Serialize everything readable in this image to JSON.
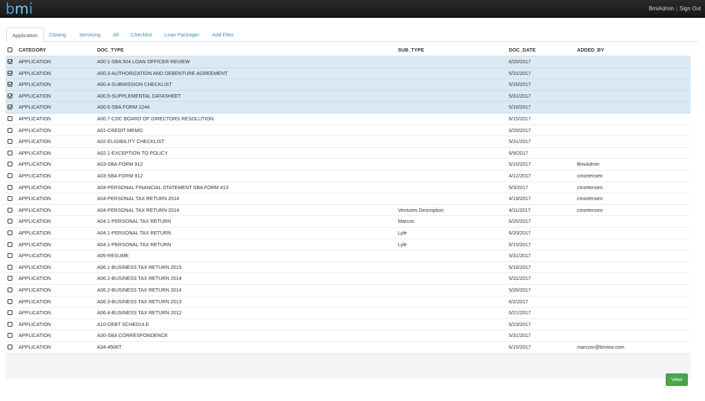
{
  "header": {
    "logo_prefix": "b",
    "logo_hl": "m",
    "logo_suffix": "i",
    "user": "BmiAdmin",
    "separator": "|",
    "signout": "Sign Out"
  },
  "tabs": [
    {
      "label": "Application",
      "active": true
    },
    {
      "label": "Closing",
      "active": false
    },
    {
      "label": "Servicing",
      "active": false
    },
    {
      "label": "All",
      "active": false
    },
    {
      "label": "Checklist",
      "active": false
    },
    {
      "label": "Loan Packager",
      "active": false
    },
    {
      "label": "Add Files",
      "active": false
    }
  ],
  "table": {
    "columns": {
      "category": "CATEGORY",
      "doc_type": "DOC_TYPE",
      "sub_type": "SUB_TYPE",
      "doc_date": "DOC_DATE",
      "added_by": "ADDED_BY"
    },
    "rows": [
      {
        "checked": true,
        "category": "APPLICATION",
        "doc_type": "A00.1-SBA 504 LOAN OFFICER REVIEW",
        "sub_type": "",
        "doc_date": "6/20/2017",
        "added_by": ""
      },
      {
        "checked": true,
        "category": "APPLICATION",
        "doc_type": "A00.3-AUTHORIZATION AND DEBENTURE AGREEMENT",
        "sub_type": "",
        "doc_date": "5/31/2017",
        "added_by": ""
      },
      {
        "checked": true,
        "category": "APPLICATION",
        "doc_type": "A00.4-SUBMISSION CHECKLIST",
        "sub_type": "",
        "doc_date": "5/16/2017",
        "added_by": ""
      },
      {
        "checked": true,
        "category": "APPLICATION",
        "doc_type": "A00.5-SUPPLEMENTAL DATASHEET",
        "sub_type": "",
        "doc_date": "5/31/2017",
        "added_by": ""
      },
      {
        "checked": true,
        "category": "APPLICATION",
        "doc_type": "A00.6-SBA FORM 1244",
        "sub_type": "",
        "doc_date": "5/16/2017",
        "added_by": ""
      },
      {
        "checked": false,
        "category": "APPLICATION",
        "doc_type": "A00.7-CDC BOARD OF DIRECTORS RESOLUTION",
        "sub_type": "",
        "doc_date": "6/15/2017",
        "added_by": ""
      },
      {
        "checked": false,
        "category": "APPLICATION",
        "doc_type": "A01-CREDIT MEMO",
        "sub_type": "",
        "doc_date": "6/20/2017",
        "added_by": ""
      },
      {
        "checked": false,
        "category": "APPLICATION",
        "doc_type": "A02-ELIGIBILITY CHECKLIST",
        "sub_type": "",
        "doc_date": "5/31/2017",
        "added_by": ""
      },
      {
        "checked": false,
        "category": "APPLICATION",
        "doc_type": "A02.1-EXCEPTION TO POLICY",
        "sub_type": "",
        "doc_date": "6/9/2017",
        "added_by": ""
      },
      {
        "checked": false,
        "category": "APPLICATION",
        "doc_type": "A03-SBA FORM 912",
        "sub_type": "",
        "doc_date": "5/10/2017",
        "added_by": "BmiAdmin"
      },
      {
        "checked": false,
        "category": "APPLICATION",
        "doc_type": "A03-SBA FORM 912",
        "sub_type": "",
        "doc_date": "4/12/2017",
        "added_by": "cmortensen"
      },
      {
        "checked": false,
        "category": "APPLICATION",
        "doc_type": "A04-PERSONAL FINANCIAL STATEMENT SBA FORM 413",
        "sub_type": "",
        "doc_date": "5/3/2017",
        "added_by": "cmortensen"
      },
      {
        "checked": false,
        "category": "APPLICATION",
        "doc_type": "A04-PERSONAL TAX RETURN 2014",
        "sub_type": "",
        "doc_date": "4/19/2017",
        "added_by": "cmortensen"
      },
      {
        "checked": false,
        "category": "APPLICATION",
        "doc_type": "A04-PERSONAL TAX RETURN 2014",
        "sub_type": "Ventures Description",
        "doc_date": "4/11/2017",
        "added_by": "cmortensen"
      },
      {
        "checked": false,
        "category": "APPLICATION",
        "doc_type": "A04.1-PERSONAL TAX RETURN",
        "sub_type": "Marcos",
        "doc_date": "6/20/2017",
        "added_by": ""
      },
      {
        "checked": false,
        "category": "APPLICATION",
        "doc_type": "A04.1-PERSONAL TAX RETURN",
        "sub_type": "Lyle",
        "doc_date": "6/20/2017",
        "added_by": ""
      },
      {
        "checked": false,
        "category": "APPLICATION",
        "doc_type": "A04.1-PERSONAL TAX RETURN",
        "sub_type": "Lyle",
        "doc_date": "6/15/2017",
        "added_by": ""
      },
      {
        "checked": false,
        "category": "APPLICATION",
        "doc_type": "A05-RESUME",
        "sub_type": "",
        "doc_date": "5/31/2017",
        "added_by": ""
      },
      {
        "checked": false,
        "category": "APPLICATION",
        "doc_type": "A06.1-BUSINESS TAX RETURN 2015",
        "sub_type": "",
        "doc_date": "5/16/2017",
        "added_by": ""
      },
      {
        "checked": false,
        "category": "APPLICATION",
        "doc_type": "A06.2-BUSINESS TAX RETURN 2014",
        "sub_type": "",
        "doc_date": "5/31/2017",
        "added_by": ""
      },
      {
        "checked": false,
        "category": "APPLICATION",
        "doc_type": "A06.2-BUSINESS TAX RETURN 2014",
        "sub_type": "",
        "doc_date": "5/26/2017",
        "added_by": ""
      },
      {
        "checked": false,
        "category": "APPLICATION",
        "doc_type": "A06.3-BUSINESS TAX RETURN 2013",
        "sub_type": "",
        "doc_date": "6/2/2017",
        "added_by": ""
      },
      {
        "checked": false,
        "category": "APPLICATION",
        "doc_type": "A06.4-BUSINESS TAX RETURN 2012",
        "sub_type": "",
        "doc_date": "6/21/2017",
        "added_by": ""
      },
      {
        "checked": false,
        "category": "APPLICATION",
        "doc_type": "A10-DEBT SCHEDULE",
        "sub_type": "",
        "doc_date": "6/23/2017",
        "added_by": ""
      },
      {
        "checked": false,
        "category": "APPLICATION",
        "doc_type": "A30-SBA CORRESPONDENCE",
        "sub_type": "",
        "doc_date": "5/31/2017",
        "added_by": ""
      },
      {
        "checked": false,
        "category": "APPLICATION",
        "doc_type": "A34-4506T",
        "sub_type": "",
        "doc_date": "6/15/2017",
        "added_by": "marcosr@bmisw.com"
      }
    ]
  },
  "actions": {
    "view_label": "View"
  },
  "colors": {
    "topbar": "#1e1e1e",
    "logo": "#3fa0e0",
    "tab_link": "#3a87b8",
    "selected_row": "#d9eaf5",
    "view_button": "#4aa54a"
  }
}
